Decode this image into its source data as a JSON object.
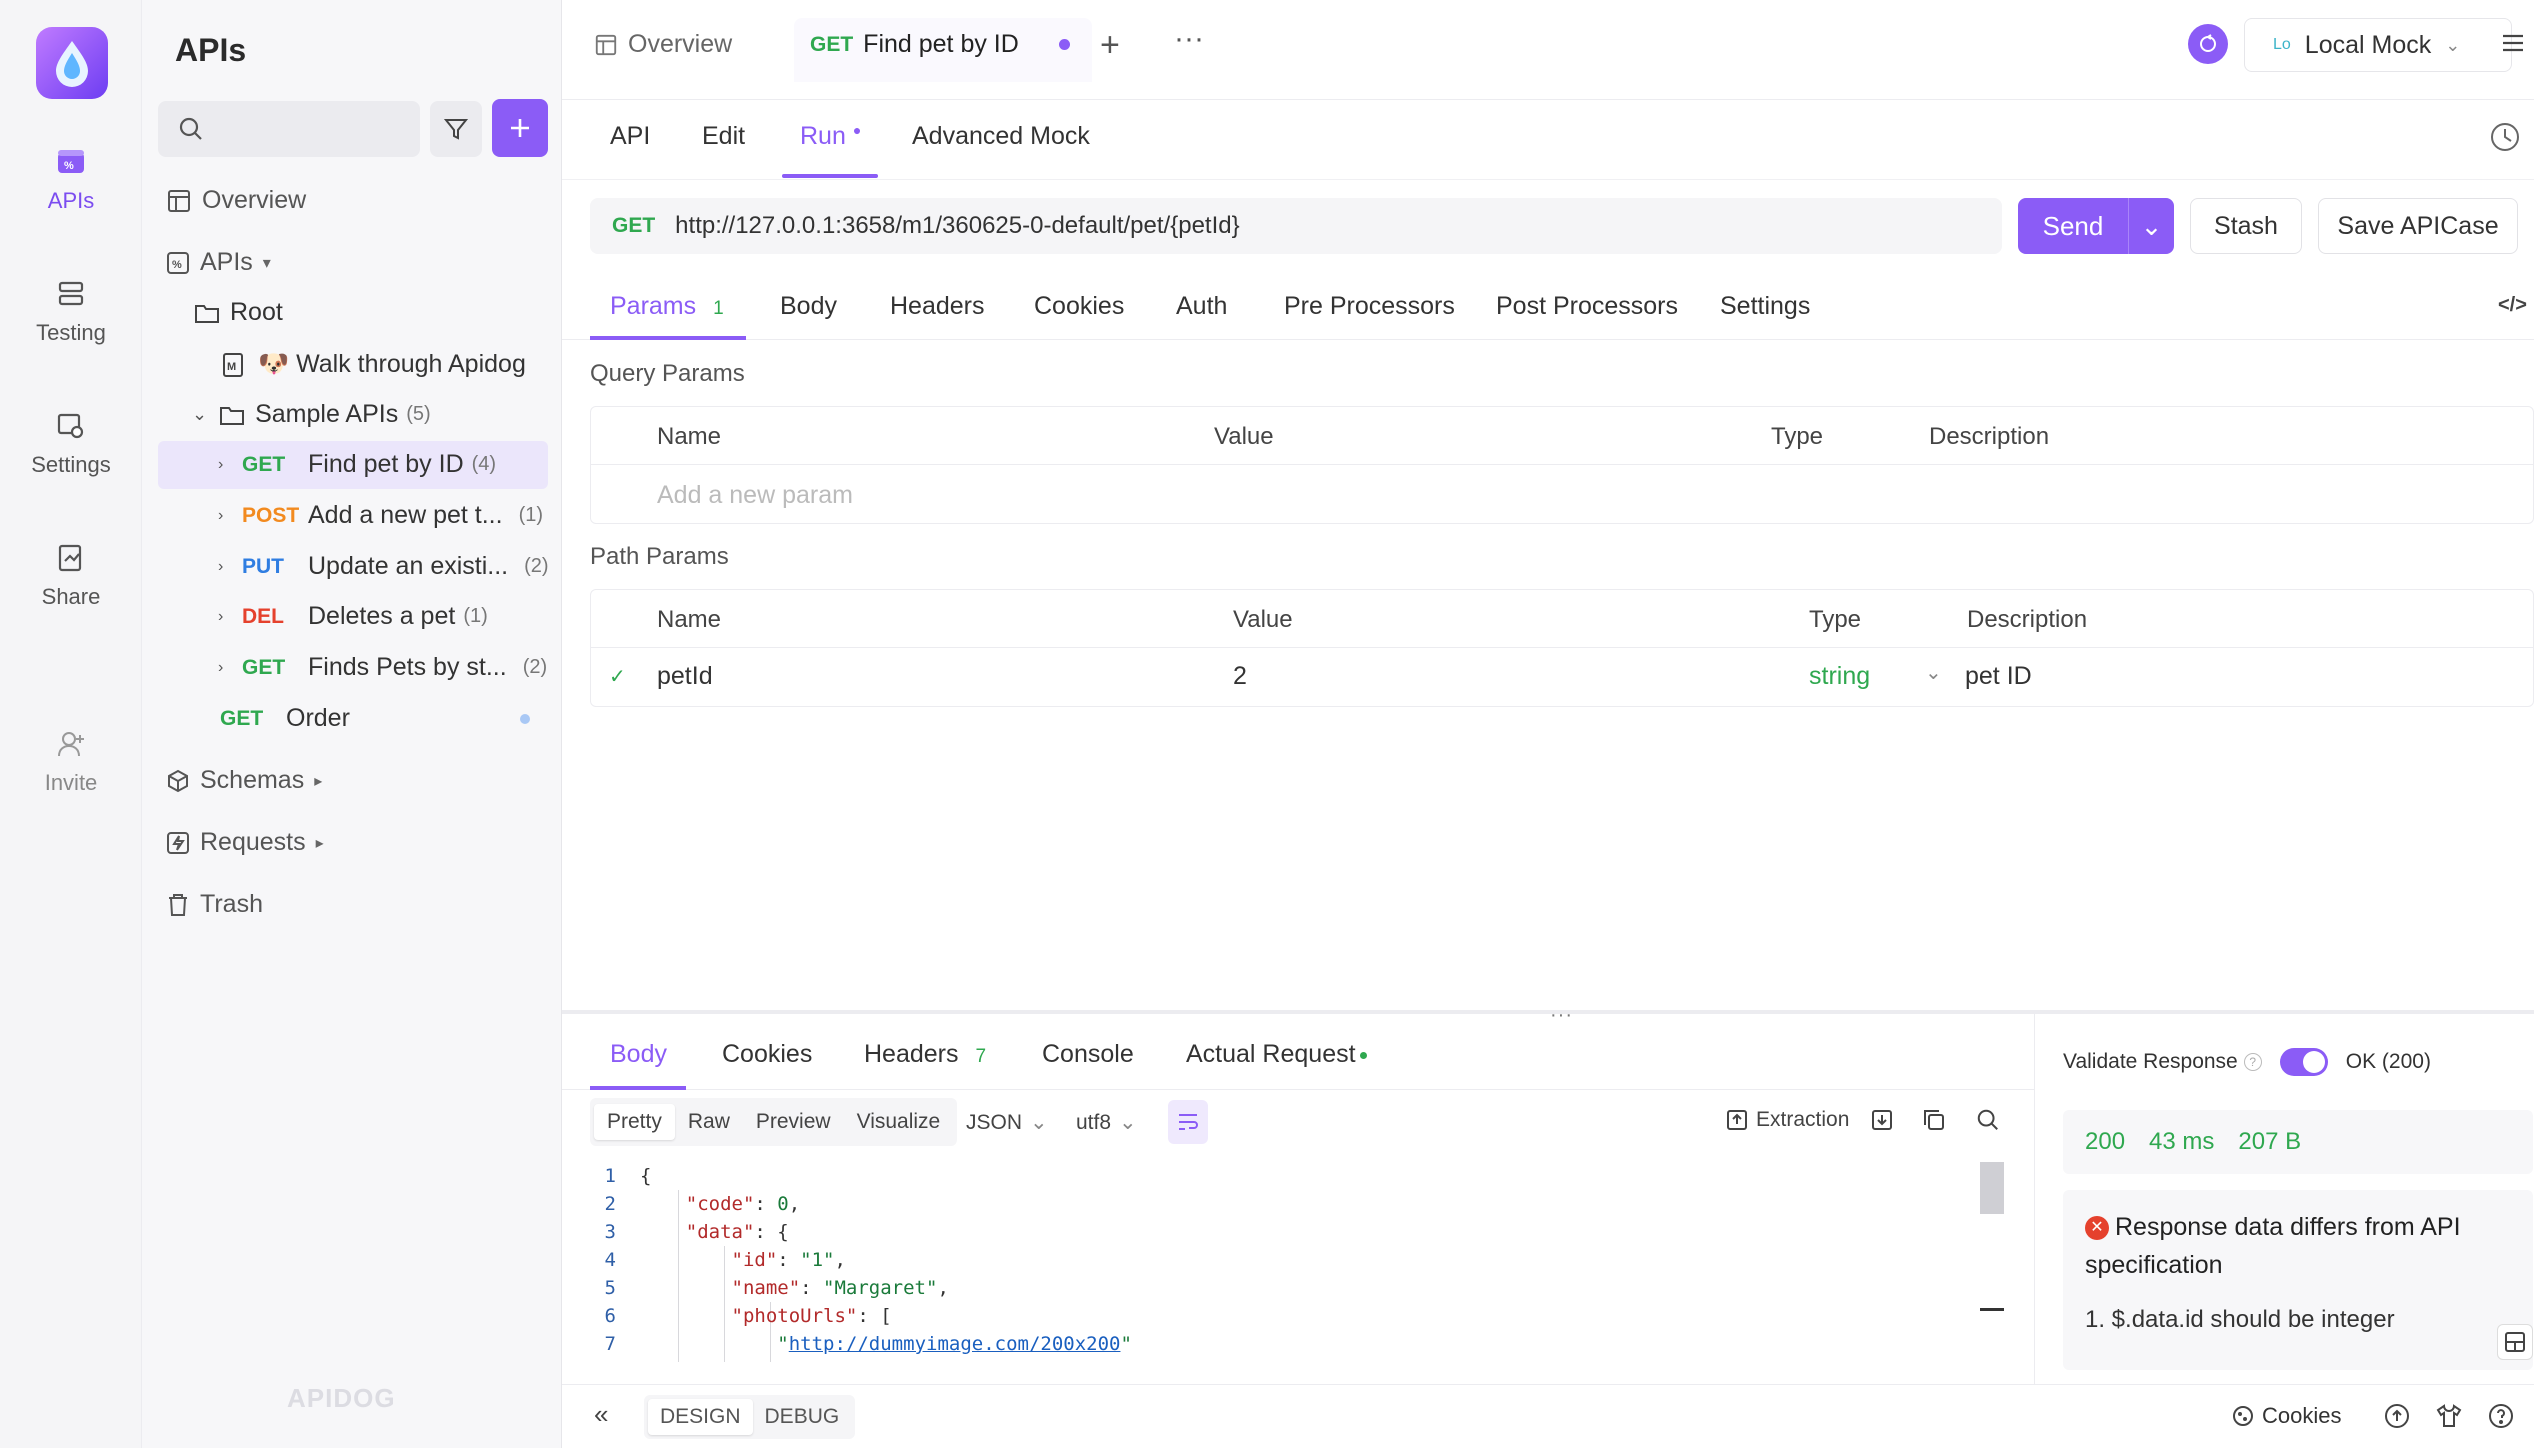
{
  "rail": {
    "items": [
      {
        "label": "APIs",
        "icon": "apis-icon"
      },
      {
        "label": "Testing",
        "icon": "testing-icon"
      },
      {
        "label": "Settings",
        "icon": "settings-icon"
      },
      {
        "label": "Share",
        "icon": "share-icon"
      },
      {
        "label": "Invite",
        "icon": "invite-icon"
      }
    ]
  },
  "sidebar": {
    "title": "APIs",
    "search_placeholder": "",
    "nav": {
      "overview": "Overview",
      "apis": "APIs",
      "root": "Root",
      "walk": "🐶 Walk through Apidog",
      "sample": "Sample APIs",
      "sample_count": "(5)",
      "schemas": "Schemas",
      "requests": "Requests",
      "trash": "Trash"
    },
    "endpoints": [
      {
        "method": "GET",
        "name": "Find pet by ID",
        "count": "(4)"
      },
      {
        "method": "POST",
        "name": "Add a new pet t...",
        "count": "(1)"
      },
      {
        "method": "PUT",
        "name": "Update an existi...",
        "count": "(2)"
      },
      {
        "method": "DEL",
        "name": "Deletes a pet",
        "count": "(1)"
      },
      {
        "method": "GET",
        "name": "Finds Pets by st...",
        "count": "(2)"
      }
    ],
    "order": {
      "method": "GET",
      "name": "Order"
    },
    "watermark": "APIDOG"
  },
  "tabs": {
    "overview": "Overview",
    "active_method": "GET",
    "active_name": "Find pet by ID"
  },
  "env": {
    "badge": "Lo",
    "name": "Local Mock"
  },
  "subtabs": {
    "api": "API",
    "edit": "Edit",
    "run": "Run",
    "mock": "Advanced Mock"
  },
  "request": {
    "method": "GET",
    "url": "http://127.0.0.1:3658/m1/360625-0-default/pet/{petId}",
    "send": "Send",
    "stash": "Stash",
    "save": "Save APICase"
  },
  "param_tabs": {
    "params": "Params",
    "params_count": "1",
    "body": "Body",
    "headers": "Headers",
    "cookies": "Cookies",
    "auth": "Auth",
    "pre": "Pre Processors",
    "post": "Post Processors",
    "settings": "Settings"
  },
  "query": {
    "label": "Query Params",
    "cols": {
      "name": "Name",
      "value": "Value",
      "type": "Type",
      "desc": "Description"
    },
    "placeholder": "Add a new param"
  },
  "path": {
    "label": "Path Params",
    "cols": {
      "name": "Name",
      "value": "Value",
      "type": "Type",
      "desc": "Description"
    },
    "row": {
      "name": "petId",
      "value": "2",
      "type": "string",
      "desc": "pet ID"
    }
  },
  "response": {
    "tabs": {
      "body": "Body",
      "cookies": "Cookies",
      "headers": "Headers",
      "headers_count": "7",
      "console": "Console",
      "actual": "Actual Request"
    },
    "views": {
      "pretty": "Pretty",
      "raw": "Raw",
      "preview": "Preview",
      "visualize": "Visualize"
    },
    "format": "JSON",
    "encoding": "utf8",
    "extraction": "Extraction",
    "lines": [
      "1",
      "2",
      "3",
      "4",
      "5",
      "6",
      "7"
    ]
  },
  "validate": {
    "label": "Validate Response",
    "status_option": "OK (200)",
    "code": "200",
    "time": "43 ms",
    "size": "207 B",
    "error_title": "Response data differs from API specification",
    "error_item": "1. $.data.id should be integer"
  },
  "bottom": {
    "design": "DESIGN",
    "debug": "DEBUG",
    "cookies": "Cookies"
  },
  "colors": {
    "accent": "#8b5cf6",
    "get": "#2fa84f",
    "post": "#f28a1f",
    "put": "#2f7de1",
    "del": "#e5412d"
  }
}
